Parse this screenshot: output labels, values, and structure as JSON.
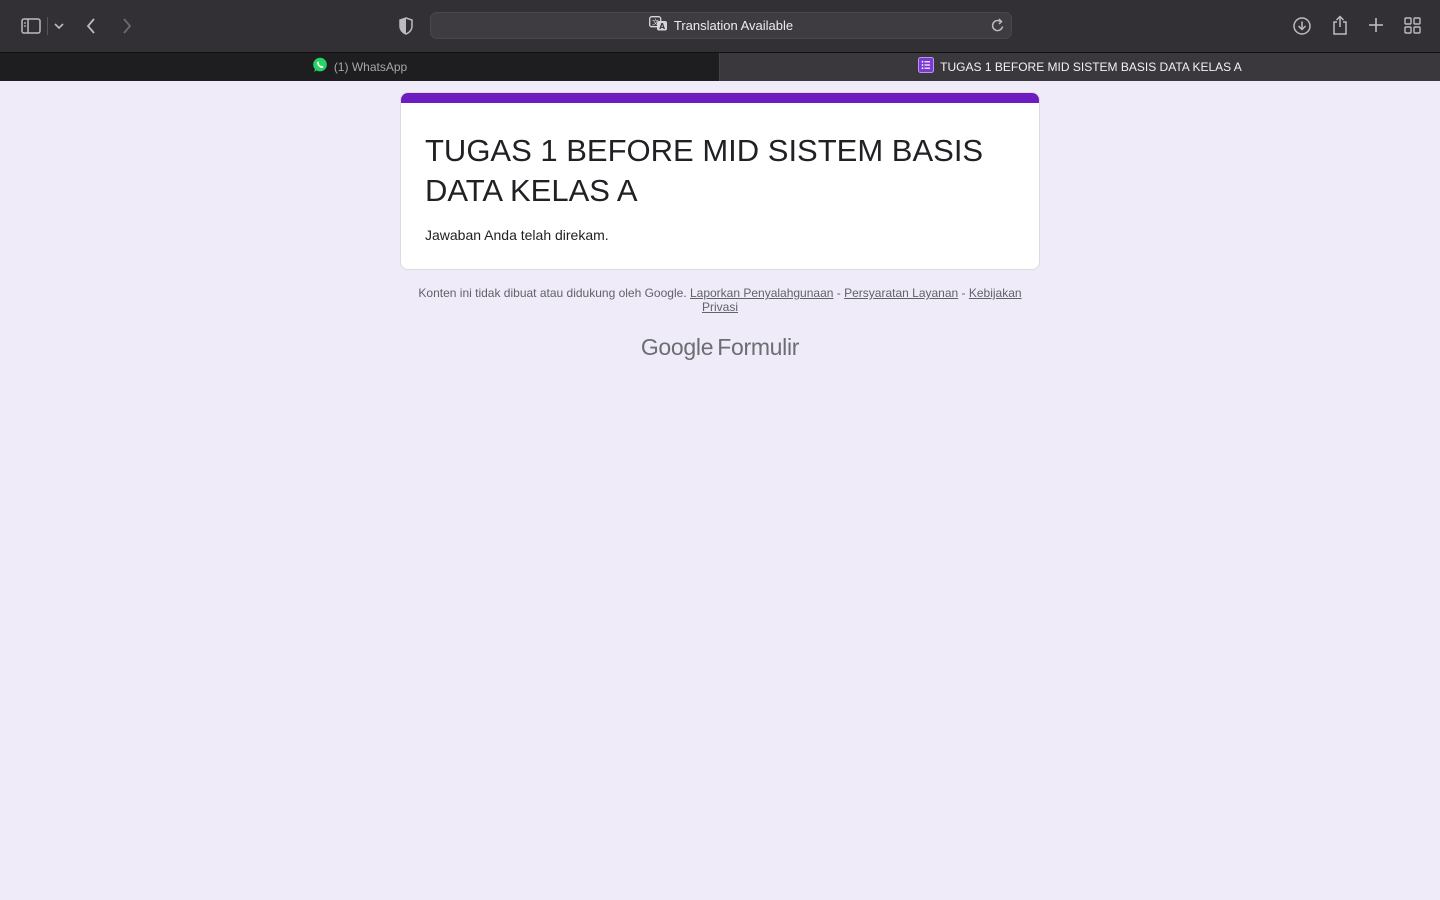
{
  "browser": {
    "address_text": "Translation Available",
    "icons": {
      "sidebar": "sidebar-icon",
      "sidebar_menu": "chevron-down-icon",
      "back": "chevron-left-icon",
      "forward": "chevron-right-icon",
      "privacy": "shield-icon",
      "translate": "translate-icon",
      "reload": "reload-icon",
      "download": "download-icon",
      "share": "share-icon",
      "new_tab": "plus-icon",
      "tab_overview": "grid-icon"
    }
  },
  "tabs": [
    {
      "label": "(1) WhatsApp",
      "icon": "whatsapp-icon",
      "active": false
    },
    {
      "label": "TUGAS 1 BEFORE MID SISTEM BASIS DATA KELAS A",
      "icon": "forms-icon",
      "active": true
    }
  ],
  "form": {
    "title": "TUGAS 1 BEFORE MID SISTEM BASIS DATA KELAS A",
    "message": "Jawaban Anda telah direkam.",
    "accent_color": "#6e1bbf"
  },
  "footer": {
    "disclaimer": "Konten ini tidak dibuat atau didukung oleh Google.",
    "links": [
      "Laporkan Penyalahgunaan",
      "Persyaratan Layanan",
      "Kebijakan Privasi"
    ],
    "separator": " - "
  },
  "brand": {
    "google": "Google",
    "product": "Formulir"
  }
}
